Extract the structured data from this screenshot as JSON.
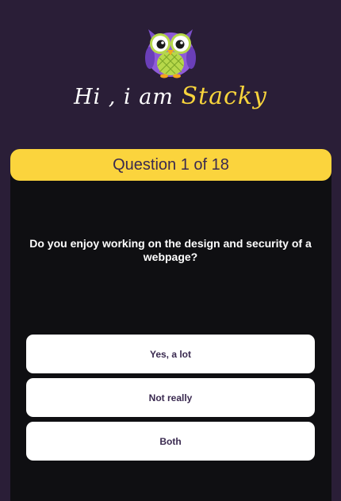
{
  "header": {
    "greeting_prefix": "Hi , i am ",
    "name": "Stacky",
    "icon": "owl-icon"
  },
  "quiz": {
    "progress_label": "Question 1 of 18",
    "current_question": 1,
    "total_questions": 18,
    "question": "Do you enjoy working on the design and security of a webpage?",
    "answers": [
      "Yes, a lot",
      "Not really",
      "Both"
    ]
  },
  "colors": {
    "background": "#2a1e37",
    "card": "#0f0f12",
    "accent": "#fbd43d",
    "answer_bg": "#ffffff",
    "answer_text": "#3a2a50"
  }
}
